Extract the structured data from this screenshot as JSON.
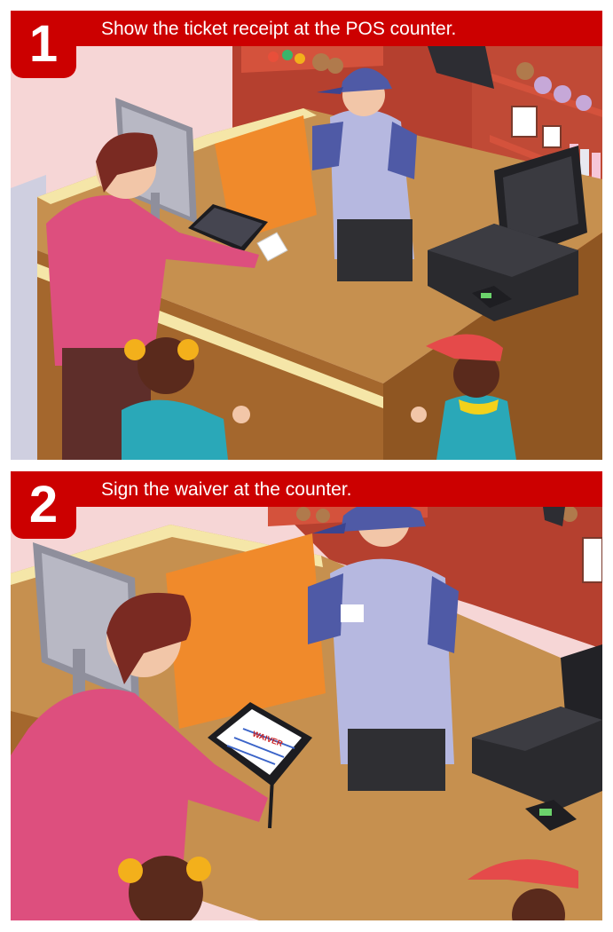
{
  "steps": [
    {
      "number": "1",
      "instruction": "Show the ticket receipt at the POS counter."
    },
    {
      "number": "2",
      "instruction": "Sign the waiver at the counter.",
      "tablet_text": "WAIVER"
    }
  ],
  "colors": {
    "banner_red": "#cc0000",
    "counter_wood": "#c6904f",
    "wall_red": "#b5402f",
    "wall_pink": "#f6d6d6",
    "orange_panel": "#f08a2b",
    "customer_shirt": "#dd4f7e",
    "staff_shirt": "#b6b8e0",
    "staff_cap": "#4f5aa6",
    "kid_shirt": "#2aa8b8",
    "kid_cap": "#e54a4a"
  },
  "icons": [
    "shelf-toys",
    "pos-register",
    "card-terminal",
    "signature-tablet",
    "monitor",
    "receipt"
  ]
}
